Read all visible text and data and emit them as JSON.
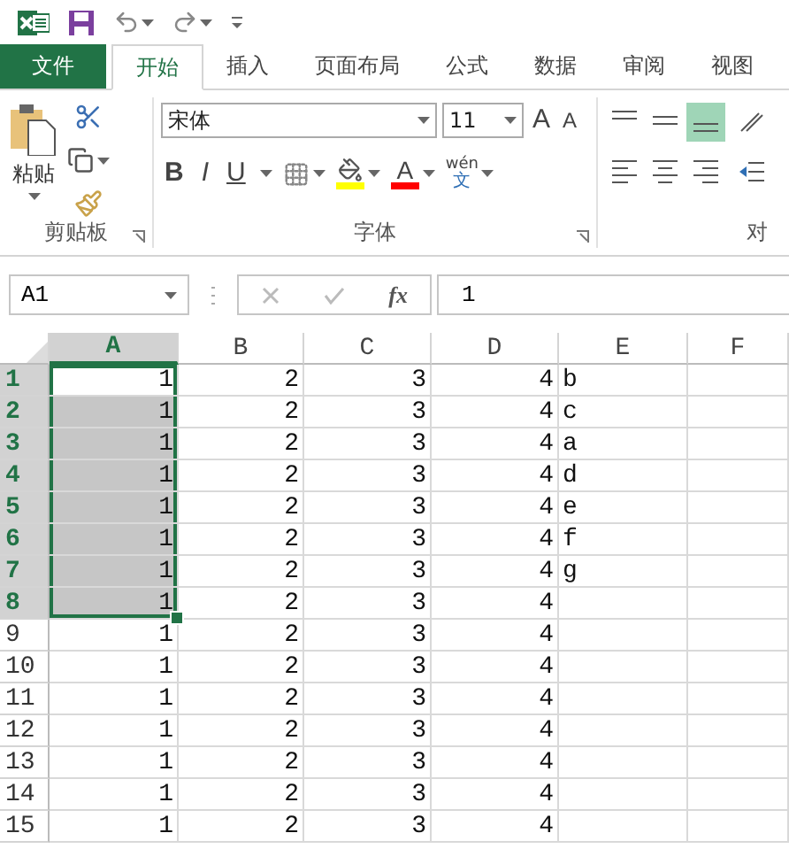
{
  "tabs": [
    {
      "label": "文件",
      "kind": "file",
      "selected": false
    },
    {
      "label": "开始",
      "kind": "tab",
      "selected": true
    },
    {
      "label": "插入",
      "kind": "tab",
      "selected": false
    },
    {
      "label": "页面布局",
      "kind": "tab",
      "selected": false
    },
    {
      "label": "公式",
      "kind": "tab",
      "selected": false
    },
    {
      "label": "数据",
      "kind": "tab",
      "selected": false
    },
    {
      "label": "审阅",
      "kind": "tab",
      "selected": false
    },
    {
      "label": "视图",
      "kind": "tab",
      "selected": false
    }
  ],
  "ribbon": {
    "clipboard": {
      "label": "剪贴板",
      "paste_label": "粘贴"
    },
    "font": {
      "label": "字体",
      "font_name": "宋体",
      "font_size": "11",
      "grow": "A",
      "shrink": "A",
      "bold": "B",
      "italic": "I",
      "underline": "U",
      "font_color": "A",
      "phonetic_top": "wén",
      "phonetic_bottom": "文"
    },
    "alignment": {
      "label": "对",
      "vertical": [
        {
          "kind": "top",
          "selected": false
        },
        {
          "kind": "middle",
          "selected": false
        },
        {
          "kind": "bottom",
          "selected": true
        }
      ],
      "horizontal": [
        {
          "kind": "left",
          "selected": false
        },
        {
          "kind": "center",
          "selected": false
        },
        {
          "kind": "right",
          "selected": false
        }
      ]
    }
  },
  "formula_bar": {
    "name_box": "A1",
    "function_label": "fx",
    "formula": "1"
  },
  "sheet": {
    "columns": [
      {
        "label": "A",
        "selected": true
      },
      {
        "label": "B",
        "selected": false
      },
      {
        "label": "C",
        "selected": false
      },
      {
        "label": "D",
        "selected": false
      },
      {
        "label": "E",
        "selected": false
      },
      {
        "label": "F",
        "selected": false
      }
    ],
    "rows": [
      {
        "label": "1",
        "selected": true,
        "cells": [
          "1",
          "2",
          "3",
          "4",
          "b"
        ]
      },
      {
        "label": "2",
        "selected": true,
        "cells": [
          "1",
          "2",
          "3",
          "4",
          "c"
        ]
      },
      {
        "label": "3",
        "selected": true,
        "cells": [
          "1",
          "2",
          "3",
          "4",
          "a"
        ]
      },
      {
        "label": "4",
        "selected": true,
        "cells": [
          "1",
          "2",
          "3",
          "4",
          "d"
        ]
      },
      {
        "label": "5",
        "selected": true,
        "cells": [
          "1",
          "2",
          "3",
          "4",
          "e"
        ]
      },
      {
        "label": "6",
        "selected": true,
        "cells": [
          "1",
          "2",
          "3",
          "4",
          "f"
        ]
      },
      {
        "label": "7",
        "selected": true,
        "cells": [
          "1",
          "2",
          "3",
          "4",
          "g"
        ]
      },
      {
        "label": "8",
        "selected": true,
        "cells": [
          "1",
          "2",
          "3",
          "4"
        ]
      },
      {
        "label": "9",
        "selected": false,
        "cells": [
          "1",
          "2",
          "3",
          "4"
        ]
      },
      {
        "label": "10",
        "selected": false,
        "cells": [
          "1",
          "2",
          "3",
          "4"
        ]
      },
      {
        "label": "11",
        "selected": false,
        "cells": [
          "1",
          "2",
          "3",
          "4"
        ]
      },
      {
        "label": "12",
        "selected": false,
        "cells": [
          "1",
          "2",
          "3",
          "4"
        ]
      },
      {
        "label": "13",
        "selected": false,
        "cells": [
          "1",
          "2",
          "3",
          "4"
        ]
      },
      {
        "label": "14",
        "selected": false,
        "cells": [
          "1",
          "2",
          "3",
          "4"
        ]
      },
      {
        "label": "15",
        "selected": false,
        "cells": [
          "1",
          "2",
          "3",
          "4"
        ]
      }
    ]
  }
}
